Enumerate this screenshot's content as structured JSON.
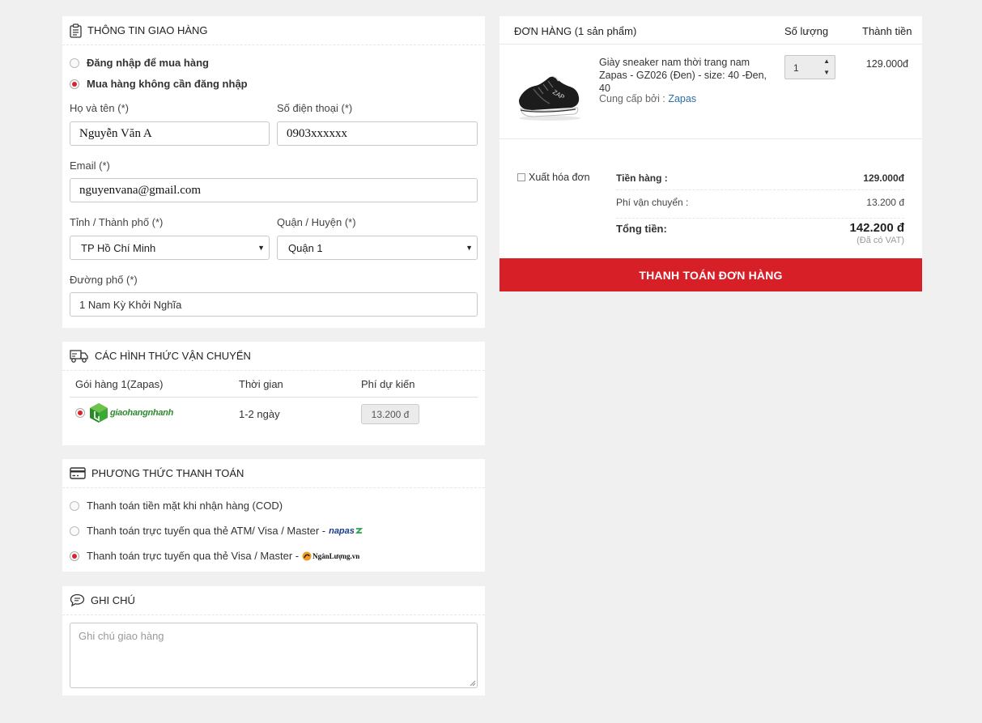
{
  "shipping_info": {
    "title": "THÔNG TIN GIAO HÀNG",
    "login_option": "Đăng nhập để mua hàng",
    "guest_option": "Mua hàng không cần đăng nhập",
    "name_label": "Họ và tên (*)",
    "name_value": "Nguyễn Văn A",
    "phone_label": "Số điện thoại (*)",
    "phone_value": "0903xxxxxx",
    "email_label": "Email (*)",
    "email_value": "nguyenvana@gmail.com",
    "city_label": "Tỉnh / Thành phố (*)",
    "city_value": "TP Hồ Chí Minh",
    "district_label": "Quận / Huyện (*)",
    "district_value": "Quận 1",
    "street_label": "Đường phố (*)",
    "street_value": "1 Nam Kỳ Khởi Nghĩa"
  },
  "shipping_methods": {
    "title": "CÁC HÌNH THỨC VẬN CHUYỂN",
    "col_package": "Gói hàng 1(Zapas)",
    "col_time": "Thời gian",
    "col_fee": "Phí dự kiến",
    "carrier_name": "giaohangnhanh",
    "time": "1-2 ngày",
    "fee": "13.200 đ"
  },
  "payment": {
    "title": "PHƯƠNG THỨC THANH TOÁN",
    "options": [
      "Thanh toán tiền mặt khi nhận hàng (COD)",
      "Thanh toán trực tuyến qua thẻ ATM/ Visa / Master -",
      "Thanh toán trực tuyến qua thẻ Visa / Master -"
    ],
    "napas_logo": "napas",
    "nganluong_logo": "NgânLượng.vn"
  },
  "notes": {
    "title": "GHI CHÚ",
    "placeholder": "Ghi chú giao hàng"
  },
  "order": {
    "title": "ĐƠN HÀNG (1 sản phẩm)",
    "col_qty": "Số lượng",
    "col_total": "Thành tiền",
    "product_name": "Giày sneaker nam thời trang nam Zapas - GZ026 (Đen) - size: 40 -Đen, 40",
    "supplier_label": "Cung cấp bởi :",
    "supplier": "Zapas",
    "quantity": "1",
    "line_total": "129.000đ",
    "invoice_label": "Xuất hóa đơn",
    "subtotal_label": "Tiền hàng :",
    "subtotal": "129.000đ",
    "shipping_label": "Phí vận chuyển :",
    "shipping": "13.200 đ",
    "grand_label": "Tổng tiền:",
    "grand_total": "142.200 đ",
    "vat_note": "(Đã có VAT)",
    "checkout_button": "THANH TOÁN ĐƠN HÀNG"
  },
  "colors": {
    "accent": "#d71f27",
    "link": "#2a6fa8",
    "background": "#f0f0f0"
  }
}
